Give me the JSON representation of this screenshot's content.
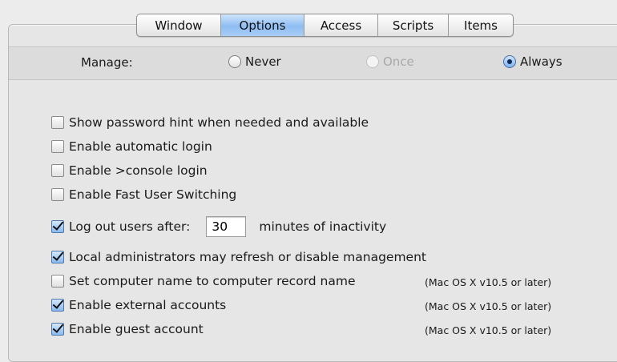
{
  "tabs": [
    {
      "label": "Window",
      "selected": false
    },
    {
      "label": "Options",
      "selected": true
    },
    {
      "label": "Access",
      "selected": false
    },
    {
      "label": "Scripts",
      "selected": false
    },
    {
      "label": "Items",
      "selected": false
    }
  ],
  "manage": {
    "label": "Manage:",
    "options": [
      {
        "label": "Never",
        "selected": false,
        "enabled": true
      },
      {
        "label": "Once",
        "selected": false,
        "enabled": false
      },
      {
        "label": "Always",
        "selected": true,
        "enabled": true
      }
    ]
  },
  "options": [
    {
      "label": "Show password hint when needed and available",
      "checked": false
    },
    {
      "label": "Enable automatic login",
      "checked": false
    },
    {
      "label": "Enable >console login",
      "checked": false
    },
    {
      "label": "Enable Fast User Switching",
      "checked": false
    },
    {
      "label": "Log out users after:",
      "checked": true,
      "value": "30",
      "suffix": "minutes of inactivity"
    },
    {
      "label": "Local administrators may refresh or disable management",
      "checked": true
    },
    {
      "label": "Set computer name to computer record name",
      "checked": false,
      "note": "(Mac OS X v10.5 or later)"
    },
    {
      "label": "Enable external accounts",
      "checked": true,
      "note": "(Mac OS X v10.5 or later)"
    },
    {
      "label": "Enable guest account",
      "checked": true,
      "note": "(Mac OS X v10.5 or later)"
    }
  ],
  "colors": {
    "selected_tab": "#8fbdf3",
    "panel_background": "#e6e6e6",
    "window_background": "#ececec"
  }
}
